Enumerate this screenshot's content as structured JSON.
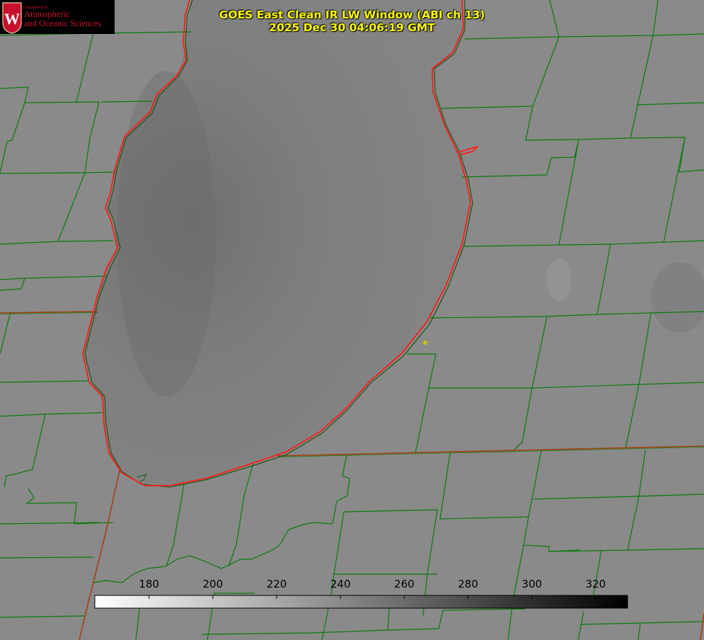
{
  "logo": {
    "emblem": "W",
    "department": "Department of",
    "line1": "Atmospheric",
    "line2": "and Oceanic Sciences"
  },
  "title": {
    "line1": "GOES East Clean IR LW Window (ABI ch 13)",
    "line2": "2025 Dec 30 04:06:19 GMT"
  },
  "colorbar": {
    "ticks": [
      180,
      200,
      220,
      240,
      260,
      280,
      300,
      320
    ],
    "min": 163,
    "max": 330,
    "colors": {
      "low": "#ffffff",
      "high": "#000000"
    }
  },
  "colors": {
    "background_gray": "#8a8a8a",
    "county_lines": "#0a7a0a",
    "state_lines": "#a04010",
    "shoreline": "#ff1a1a",
    "marker": "#c8c010",
    "title_text": "#ffff00",
    "logo_red": "#c8102e"
  }
}
